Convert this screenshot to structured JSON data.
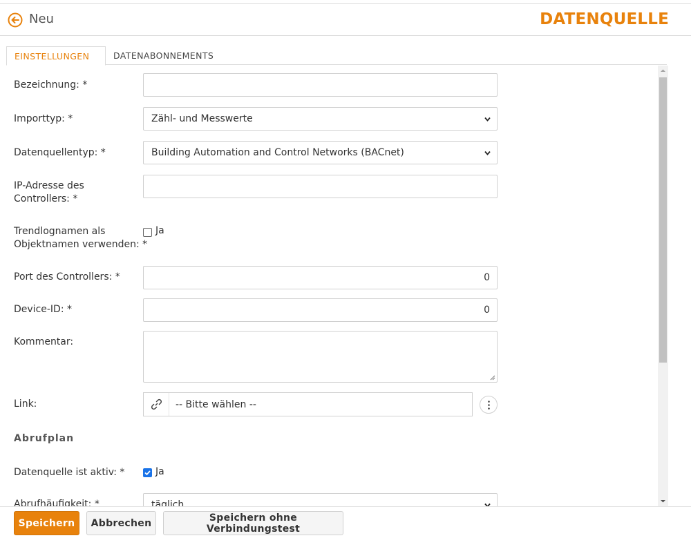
{
  "header": {
    "title": "Neu",
    "brand": "DATENQUELLE"
  },
  "tabs": [
    {
      "label": "EINSTELLUNGEN"
    },
    {
      "label": "DATENABONNEMENTS"
    }
  ],
  "form": {
    "bezeichnung": {
      "label": "Bezeichnung: *",
      "value": ""
    },
    "importtyp": {
      "label": "Importtyp: *",
      "value": "Zähl- und Messwerte"
    },
    "datenquellentyp": {
      "label": "Datenquellentyp: *",
      "value": "Building Automation and Control Networks (BACnet)"
    },
    "ip": {
      "label_line1": "IP-Adresse des",
      "label_line2": "Controllers: *",
      "value": ""
    },
    "trendlog": {
      "label_line1": "Trendlognamen als",
      "label_line2": "Objektnamen verwenden: *",
      "check_label": "Ja",
      "checked": false
    },
    "port": {
      "label": "Port des Controllers: *",
      "value": "0"
    },
    "device": {
      "label": "Device-ID: *",
      "value": "0"
    },
    "kommentar": {
      "label": "Kommentar:",
      "value": ""
    },
    "link": {
      "label": "Link:",
      "value": "-- Bitte wählen --"
    },
    "section_title": "Abrufplan",
    "aktiv": {
      "label": "Datenquelle ist aktiv: *",
      "check_label": "Ja",
      "checked": true
    },
    "abruf": {
      "label": "Abrufhäufigkeit: *",
      "value": "täglich"
    }
  },
  "footer": {
    "save": "Speichern",
    "cancel": "Abbrechen",
    "save_no_test": "Speichern ohne Verbindungstest"
  },
  "colors": {
    "accent": "#e8820c",
    "checkbox": "#1a73e8"
  }
}
